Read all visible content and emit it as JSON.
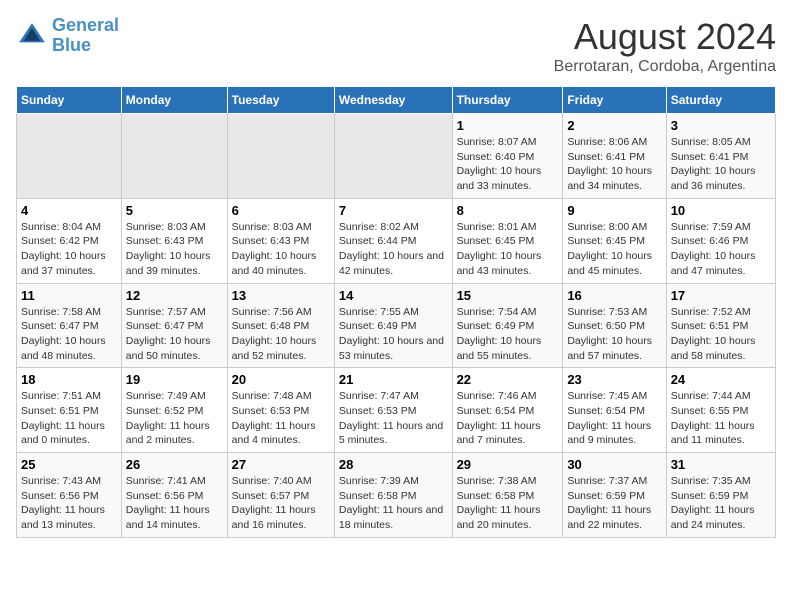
{
  "logo": {
    "line1": "General",
    "line2": "Blue"
  },
  "title": "August 2024",
  "subtitle": "Berrotaran, Cordoba, Argentina",
  "days": [
    "Sunday",
    "Monday",
    "Tuesday",
    "Wednesday",
    "Thursday",
    "Friday",
    "Saturday"
  ],
  "weeks": [
    [
      {
        "date": "",
        "empty": true
      },
      {
        "date": "",
        "empty": true
      },
      {
        "date": "",
        "empty": true
      },
      {
        "date": "",
        "empty": true
      },
      {
        "date": "1",
        "sunrise": "8:07 AM",
        "sunset": "6:40 PM",
        "daylight": "10 hours and 33 minutes."
      },
      {
        "date": "2",
        "sunrise": "8:06 AM",
        "sunset": "6:41 PM",
        "daylight": "10 hours and 34 minutes."
      },
      {
        "date": "3",
        "sunrise": "8:05 AM",
        "sunset": "6:41 PM",
        "daylight": "10 hours and 36 minutes."
      }
    ],
    [
      {
        "date": "4",
        "sunrise": "8:04 AM",
        "sunset": "6:42 PM",
        "daylight": "10 hours and 37 minutes."
      },
      {
        "date": "5",
        "sunrise": "8:03 AM",
        "sunset": "6:43 PM",
        "daylight": "10 hours and 39 minutes."
      },
      {
        "date": "6",
        "sunrise": "8:03 AM",
        "sunset": "6:43 PM",
        "daylight": "10 hours and 40 minutes."
      },
      {
        "date": "7",
        "sunrise": "8:02 AM",
        "sunset": "6:44 PM",
        "daylight": "10 hours and 42 minutes."
      },
      {
        "date": "8",
        "sunrise": "8:01 AM",
        "sunset": "6:45 PM",
        "daylight": "10 hours and 43 minutes."
      },
      {
        "date": "9",
        "sunrise": "8:00 AM",
        "sunset": "6:45 PM",
        "daylight": "10 hours and 45 minutes."
      },
      {
        "date": "10",
        "sunrise": "7:59 AM",
        "sunset": "6:46 PM",
        "daylight": "10 hours and 47 minutes."
      }
    ],
    [
      {
        "date": "11",
        "sunrise": "7:58 AM",
        "sunset": "6:47 PM",
        "daylight": "10 hours and 48 minutes."
      },
      {
        "date": "12",
        "sunrise": "7:57 AM",
        "sunset": "6:47 PM",
        "daylight": "10 hours and 50 minutes."
      },
      {
        "date": "13",
        "sunrise": "7:56 AM",
        "sunset": "6:48 PM",
        "daylight": "10 hours and 52 minutes."
      },
      {
        "date": "14",
        "sunrise": "7:55 AM",
        "sunset": "6:49 PM",
        "daylight": "10 hours and 53 minutes."
      },
      {
        "date": "15",
        "sunrise": "7:54 AM",
        "sunset": "6:49 PM",
        "daylight": "10 hours and 55 minutes."
      },
      {
        "date": "16",
        "sunrise": "7:53 AM",
        "sunset": "6:50 PM",
        "daylight": "10 hours and 57 minutes."
      },
      {
        "date": "17",
        "sunrise": "7:52 AM",
        "sunset": "6:51 PM",
        "daylight": "10 hours and 58 minutes."
      }
    ],
    [
      {
        "date": "18",
        "sunrise": "7:51 AM",
        "sunset": "6:51 PM",
        "daylight": "11 hours and 0 minutes."
      },
      {
        "date": "19",
        "sunrise": "7:49 AM",
        "sunset": "6:52 PM",
        "daylight": "11 hours and 2 minutes."
      },
      {
        "date": "20",
        "sunrise": "7:48 AM",
        "sunset": "6:53 PM",
        "daylight": "11 hours and 4 minutes."
      },
      {
        "date": "21",
        "sunrise": "7:47 AM",
        "sunset": "6:53 PM",
        "daylight": "11 hours and 5 minutes."
      },
      {
        "date": "22",
        "sunrise": "7:46 AM",
        "sunset": "6:54 PM",
        "daylight": "11 hours and 7 minutes."
      },
      {
        "date": "23",
        "sunrise": "7:45 AM",
        "sunset": "6:54 PM",
        "daylight": "11 hours and 9 minutes."
      },
      {
        "date": "24",
        "sunrise": "7:44 AM",
        "sunset": "6:55 PM",
        "daylight": "11 hours and 11 minutes."
      }
    ],
    [
      {
        "date": "25",
        "sunrise": "7:43 AM",
        "sunset": "6:56 PM",
        "daylight": "11 hours and 13 minutes."
      },
      {
        "date": "26",
        "sunrise": "7:41 AM",
        "sunset": "6:56 PM",
        "daylight": "11 hours and 14 minutes."
      },
      {
        "date": "27",
        "sunrise": "7:40 AM",
        "sunset": "6:57 PM",
        "daylight": "11 hours and 16 minutes."
      },
      {
        "date": "28",
        "sunrise": "7:39 AM",
        "sunset": "6:58 PM",
        "daylight": "11 hours and 18 minutes."
      },
      {
        "date": "29",
        "sunrise": "7:38 AM",
        "sunset": "6:58 PM",
        "daylight": "11 hours and 20 minutes."
      },
      {
        "date": "30",
        "sunrise": "7:37 AM",
        "sunset": "6:59 PM",
        "daylight": "11 hours and 22 minutes."
      },
      {
        "date": "31",
        "sunrise": "7:35 AM",
        "sunset": "6:59 PM",
        "daylight": "11 hours and 24 minutes."
      }
    ]
  ]
}
